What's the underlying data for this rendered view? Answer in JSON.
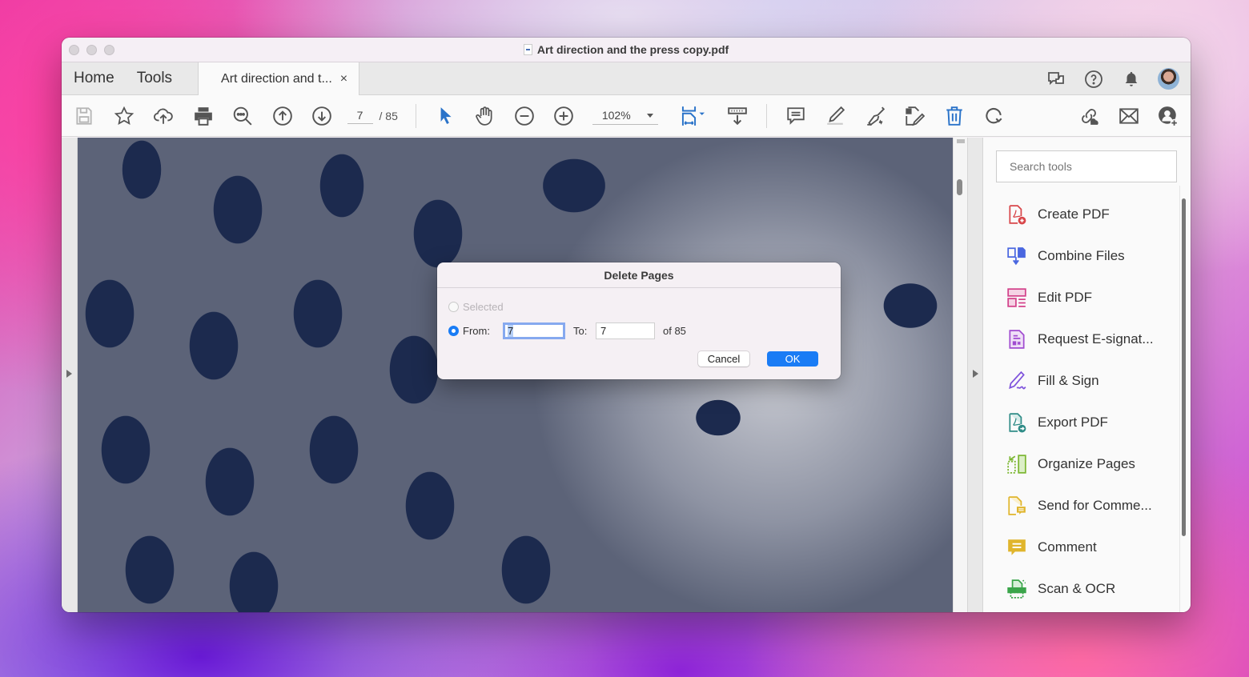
{
  "window": {
    "title": "Art direction and the press copy.pdf"
  },
  "tabbar": {
    "home": "Home",
    "tools": "Tools",
    "doc_tab": "Art direction and t...",
    "close_glyph": "×",
    "right_icons": [
      "feedback-icon",
      "help-icon",
      "bell-icon",
      "avatar"
    ]
  },
  "toolbar": {
    "page_current": "7",
    "page_total": "/ 85",
    "zoom_level": "102%",
    "accent": "#2a73c9"
  },
  "search": {
    "placeholder": "Search tools"
  },
  "tools": [
    {
      "label": "Create PDF",
      "icon": "create-pdf-icon",
      "color": "#d8464a"
    },
    {
      "label": "Combine Files",
      "icon": "combine-files-icon",
      "color": "#4a67e0"
    },
    {
      "label": "Edit PDF",
      "icon": "edit-pdf-icon",
      "color": "#d3428a"
    },
    {
      "label": "Request E-signat...",
      "icon": "request-esign-icon",
      "color": "#a04bd0"
    },
    {
      "label": "Fill & Sign",
      "icon": "fill-sign-icon",
      "color": "#7e52dc"
    },
    {
      "label": "Export PDF",
      "icon": "export-pdf-icon",
      "color": "#2f8c87"
    },
    {
      "label": "Organize Pages",
      "icon": "organize-pages-icon",
      "color": "#7cb733"
    },
    {
      "label": "Send for Comme...",
      "icon": "send-for-comment-icon",
      "color": "#e0b52c"
    },
    {
      "label": "Comment",
      "icon": "comment-icon",
      "color": "#e0b52c"
    },
    {
      "label": "Scan & OCR",
      "icon": "scan-ocr-icon",
      "color": "#3aa54a"
    }
  ],
  "dialog": {
    "title": "Delete Pages",
    "option_selected": "Selected",
    "option_from": "From:",
    "from_value": "7",
    "to_label": "To:",
    "to_value": "7",
    "of_total": "of 85",
    "cancel": "Cancel",
    "ok": "OK"
  }
}
